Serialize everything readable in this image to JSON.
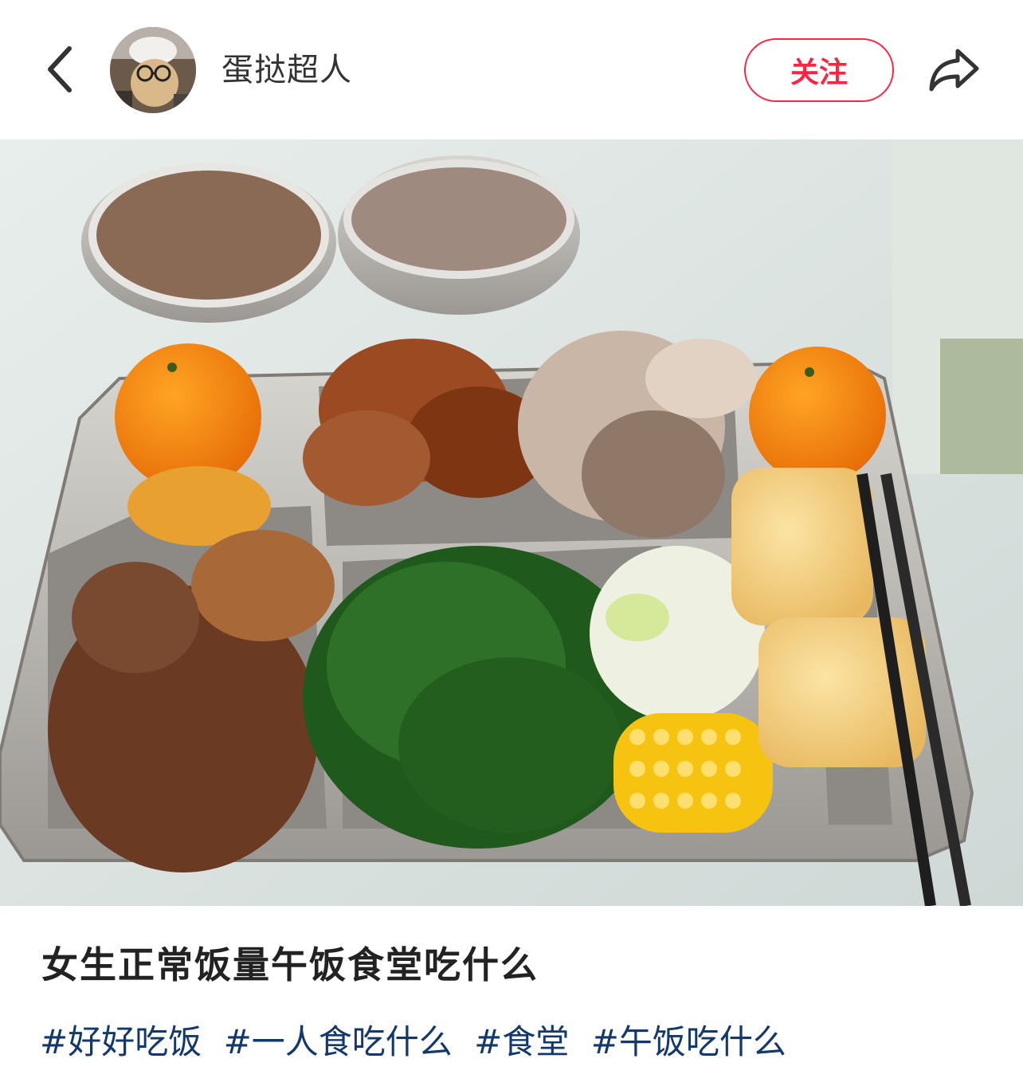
{
  "header": {
    "back_icon": "chevron-left-icon",
    "author_name": "蛋挞超人",
    "follow_label": "关注",
    "share_icon": "share-icon",
    "accent_color": "#ff2442"
  },
  "post": {
    "title": "女生正常饭量午饭食堂吃什么",
    "tags": [
      "#好好吃饭",
      "#一人食吃什么",
      "#食堂",
      "#午饭吃什么"
    ],
    "tag_color": "#13386c"
  },
  "photo": {
    "description_icon": "food-tray-photo"
  }
}
